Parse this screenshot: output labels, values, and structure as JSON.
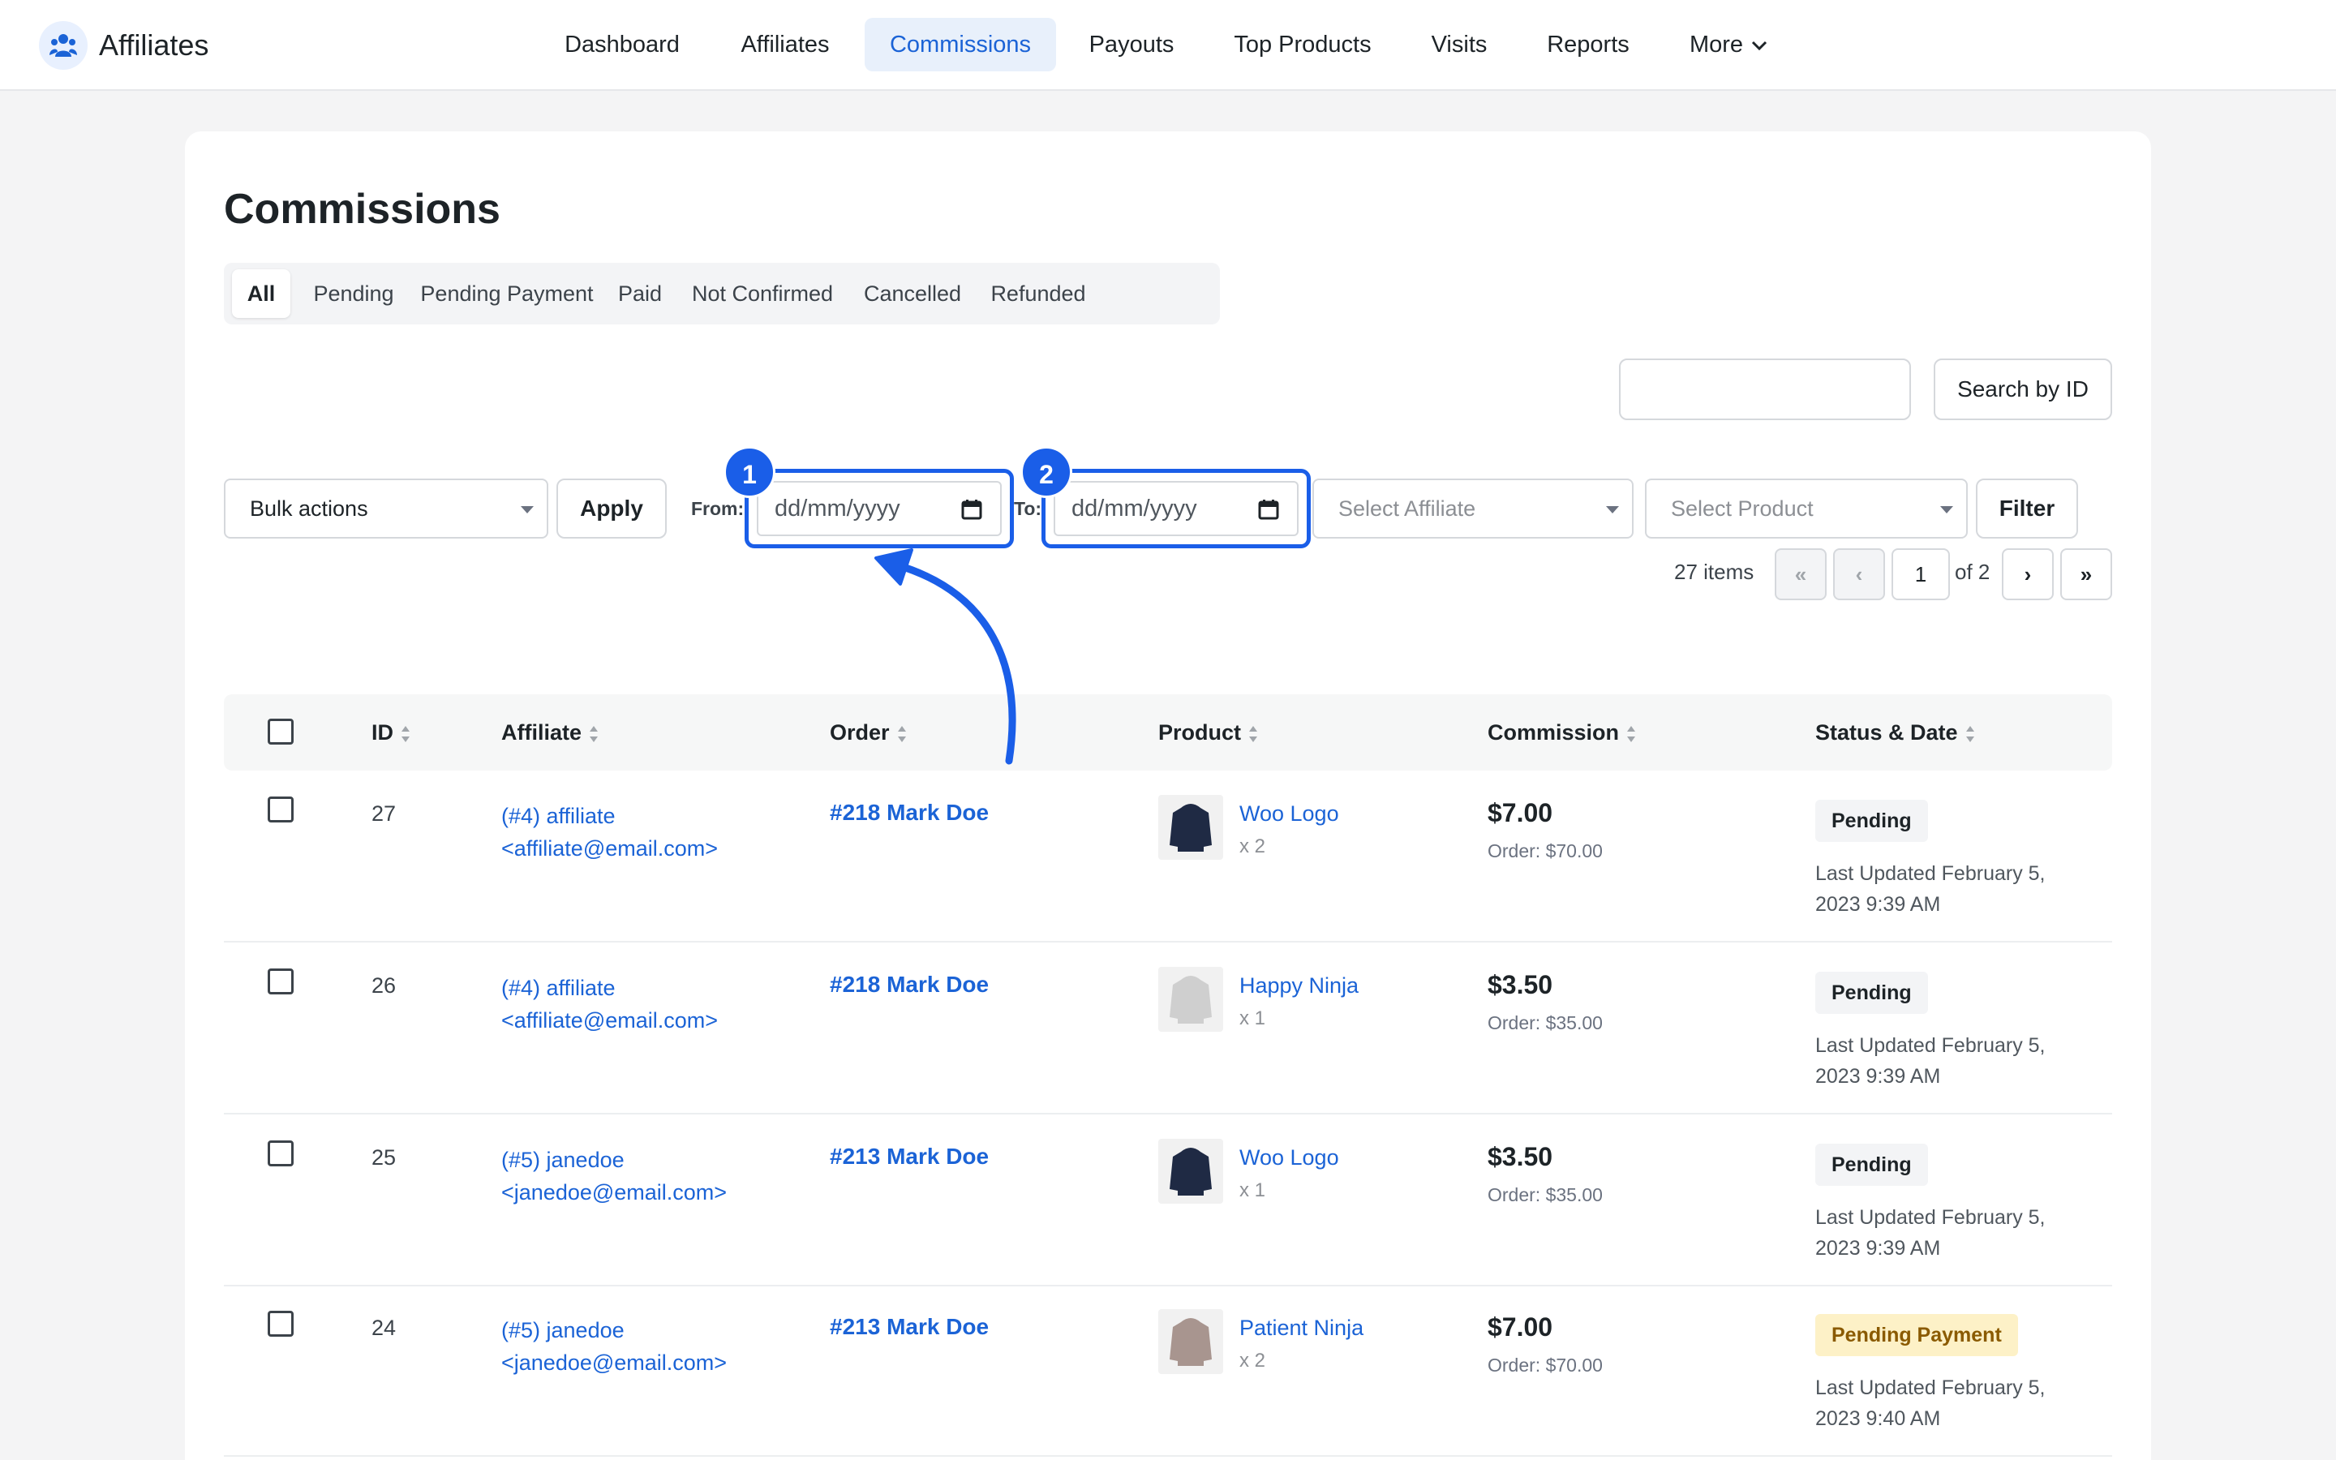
{
  "app": {
    "name": "Affiliates"
  },
  "nav": [
    {
      "label": "Dashboard"
    },
    {
      "label": "Affiliates"
    },
    {
      "label": "Commissions",
      "active": true
    },
    {
      "label": "Payouts"
    },
    {
      "label": "Top Products"
    },
    {
      "label": "Visits"
    },
    {
      "label": "Reports"
    },
    {
      "label": "More"
    }
  ],
  "page": {
    "title": "Commissions"
  },
  "status_tabs": [
    {
      "label": "All",
      "active": true
    },
    {
      "label": "Pending"
    },
    {
      "label": "Pending Payment"
    },
    {
      "label": "Paid"
    },
    {
      "label": "Not Confirmed"
    },
    {
      "label": "Cancelled"
    },
    {
      "label": "Refunded"
    }
  ],
  "search": {
    "value": "",
    "button": "Search by ID"
  },
  "filters": {
    "bulk_actions": "Bulk actions",
    "apply": "Apply",
    "from_label": "From:",
    "to_label": "To:",
    "from_value": "dd/mm/yyyy",
    "to_value": "dd/mm/yyyy",
    "select_affiliate": "Select Affiliate",
    "select_product": "Select Product",
    "filter": "Filter"
  },
  "annotations": {
    "badge1": "1",
    "badge2": "2"
  },
  "pagination": {
    "items": "27 items",
    "first": "«",
    "prev": "‹",
    "current": "1",
    "of": "of 2",
    "next": "›",
    "last": "»"
  },
  "table": {
    "columns": [
      "ID",
      "Affiliate",
      "Order",
      "Product",
      "Commission",
      "Status & Date"
    ],
    "rows": [
      {
        "id": "27",
        "affiliate_name": "(#4) affiliate",
        "affiliate_email": "<affiliate@email.com>",
        "order": "#218 Mark Doe",
        "product": "Woo Logo",
        "qty": "x 2",
        "amount": "$7.00",
        "order_total": "Order: $70.00",
        "status": "Pending",
        "updated": "Last Updated February 5, 2023 9:39 AM",
        "thumb_color": "#1f2a44"
      },
      {
        "id": "26",
        "affiliate_name": "(#4) affiliate",
        "affiliate_email": "<affiliate@email.com>",
        "order": "#218 Mark Doe",
        "product": "Happy Ninja",
        "qty": "x 1",
        "amount": "$3.50",
        "order_total": "Order: $35.00",
        "status": "Pending",
        "updated": "Last Updated February 5, 2023 9:39 AM",
        "thumb_color": "#cfcfcf"
      },
      {
        "id": "25",
        "affiliate_name": "(#5) janedoe",
        "affiliate_email": "<janedoe@email.com>",
        "order": "#213 Mark Doe",
        "product": "Woo Logo",
        "qty": "x 1",
        "amount": "$3.50",
        "order_total": "Order: $35.00",
        "status": "Pending",
        "updated": "Last Updated February 5, 2023 9:39 AM",
        "thumb_color": "#1f2a44"
      },
      {
        "id": "24",
        "affiliate_name": "(#5) janedoe",
        "affiliate_email": "<janedoe@email.com>",
        "order": "#213 Mark Doe",
        "product": "Patient Ninja",
        "qty": "x 2",
        "amount": "$7.00",
        "order_total": "Order: $70.00",
        "status": "Pending Payment",
        "updated": "Last Updated February 5, 2023 9:40 AM",
        "thumb_color": "#a8958f"
      }
    ]
  },
  "colors": {
    "accent": "#1b63d6",
    "annotation": "#1a5ee8",
    "pending_payment_bg": "#fdf1c7"
  }
}
